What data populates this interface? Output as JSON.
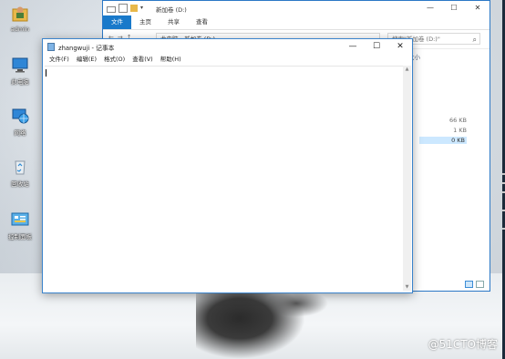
{
  "desktop": {
    "icons": [
      {
        "label": "admin",
        "icon": "user-folder-icon"
      },
      {
        "label": "此电脑",
        "icon": "computer-icon"
      },
      {
        "label": "网络",
        "icon": "network-icon"
      },
      {
        "label": "回收站",
        "icon": "recycle-bin-icon"
      },
      {
        "label": "控制面板",
        "icon": "control-panel-icon"
      }
    ]
  },
  "explorer": {
    "title": "新加卷 (D:)",
    "ribbon_tabs": [
      "文件",
      "主页",
      "共享",
      "查看"
    ],
    "breadcrumb": "此电脑 › 新加卷 (D:)",
    "search_placeholder": "搜索\"新加卷 (D:)\"",
    "column_header": "大小",
    "sizes": [
      "66 KB",
      "1 KB",
      "0 KB"
    ]
  },
  "notepad": {
    "title": "zhangwuji - 记事本",
    "menu": [
      "文件(F)",
      "编辑(E)",
      "格式(O)",
      "查看(V)",
      "帮助(H)"
    ],
    "content": ""
  },
  "window_controls": {
    "minimize": "—",
    "maximize": "☐",
    "close": "✕"
  },
  "watermark": "@51CTO博客",
  "colors": {
    "accent": "#1979ca",
    "window_border": "#3b84cc",
    "selection": "#cce8ff"
  }
}
